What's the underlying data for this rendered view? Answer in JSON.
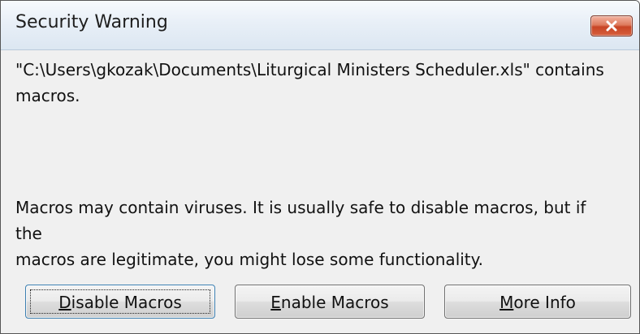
{
  "window": {
    "title": "Security Warning",
    "close_icon": "close-x-icon"
  },
  "message": {
    "file_line_1": "\"C:\\Users\\gkozak\\Documents\\Liturgical Ministers Scheduler.xls\" contains",
    "file_line_2": "macros.",
    "warning_line_1": "Macros may contain viruses. It is usually safe to disable macros, but if the",
    "warning_line_2": "macros are legitimate, you might lose some functionality."
  },
  "buttons": {
    "disable": {
      "mnemonic": "D",
      "rest": "isable Macros"
    },
    "enable": {
      "mnemonic": "E",
      "rest": "nable Macros"
    },
    "info": {
      "mnemonic": "M",
      "rest": "ore Info"
    }
  },
  "colors": {
    "dialog_bg": "#f0f0f0",
    "close_button": "#c84525",
    "focus_border": "#3c7fb1"
  }
}
